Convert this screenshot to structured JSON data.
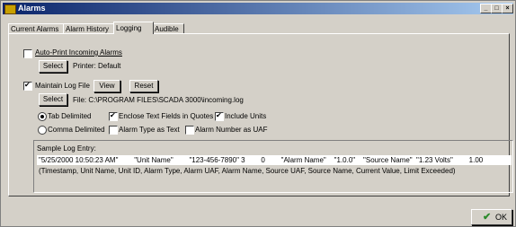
{
  "window": {
    "title": "Alarms",
    "minimize": "_",
    "restore": "□",
    "close": "×"
  },
  "tabs": [
    {
      "label": "Current Alarms"
    },
    {
      "label": "Alarm History"
    },
    {
      "label": "Logging",
      "active": true
    },
    {
      "label": "Audible"
    }
  ],
  "auto_print": {
    "label": "Auto-Print Incoming Alarms",
    "checked": false,
    "select_button": "Select",
    "printer_text": "Printer:  Default"
  },
  "maintain_log": {
    "label": "Maintain Log File",
    "checked": true,
    "view_button": "View",
    "reset_button": "Reset",
    "select_button": "Select",
    "file_text": "File:  C:\\PROGRAM FILES\\SCADA 3000\\incoming.log"
  },
  "format": {
    "tab_delimited": {
      "label": "Tab Delimited",
      "checked": true
    },
    "comma_delimited": {
      "label": "Comma Delimited",
      "checked": false
    },
    "enclose_quotes": {
      "label": "Enclose Text Fields in Quotes",
      "checked": true
    },
    "include_units": {
      "label": "Include Units",
      "checked": true
    },
    "alarm_type_text": {
      "label": "Alarm Type as Text",
      "checked": false
    },
    "alarm_number_uaf": {
      "label": "Alarm Number as UAF",
      "checked": false
    }
  },
  "sample": {
    "heading": "Sample Log Entry:",
    "line": "\"5/25/2000 10:50:23 AM\"        \"Unit Name\"        \"123-456-7890\" 3        0        \"Alarm Name\"    \"1.0.0\"    \"Source Name\"  \"1.23 Volts\"        1.00",
    "legend": "(Timestamp, Unit Name, Unit ID, Alarm Type, Alarm UAF, Alarm Name, Source UAF, Source Name, Current Value, Limit Exceeded)"
  },
  "ok_button": {
    "label": "OK",
    "icon": "checkmark-icon"
  },
  "colors": {
    "title_start": "#0a246a",
    "title_end": "#a6caf0",
    "face": "#d4d0c8"
  }
}
